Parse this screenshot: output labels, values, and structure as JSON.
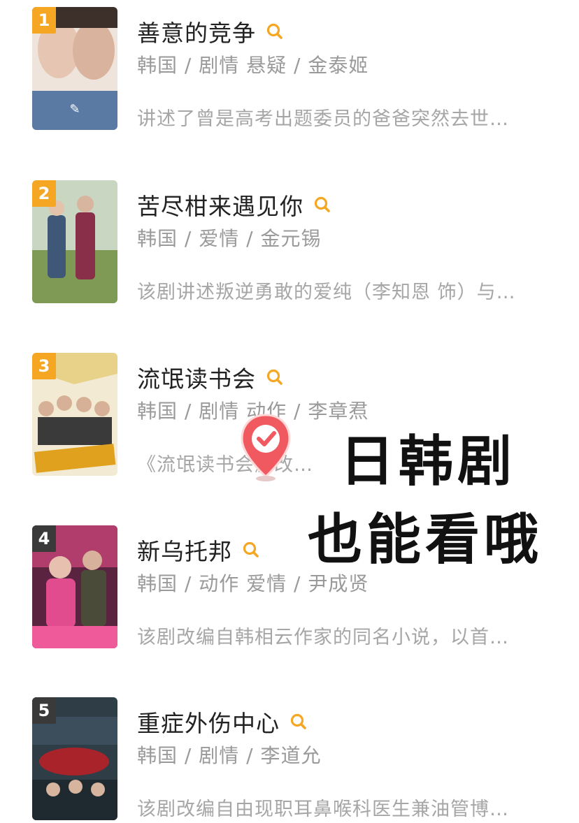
{
  "items": [
    {
      "rank": "1",
      "title": "善意的竞争",
      "meta": "韩国 / 剧情 悬疑 / 金泰姬",
      "desc": "讲述了曾是高考出题委员的爸爸突然去世…",
      "poster_colors": [
        "#e9d8cc",
        "#c89b84",
        "#4a6a8c"
      ],
      "search_icon": "search-icon"
    },
    {
      "rank": "2",
      "title": "苦尽柑来遇见你",
      "meta": "韩国 / 爱情 / 金元锡",
      "desc": "该剧讲述叛逆勇敢的爱纯（李知恩 饰）与…",
      "poster_colors": [
        "#b9c9b0",
        "#6d8a4c",
        "#8a2f4a"
      ],
      "search_icon": "search-icon"
    },
    {
      "rank": "3",
      "title": "流氓读书会",
      "meta": "韩国 / 剧情 动作 / 李章焄",
      "desc": "《流氓读书会》改编…",
      "poster_colors": [
        "#f2e7c7",
        "#d9a93a",
        "#2c2c2c"
      ],
      "search_icon": "search-icon"
    },
    {
      "rank": "4",
      "title": "新乌托邦",
      "meta": "韩国 / 动作 爱情 / 尹成贤",
      "desc": "该剧改编自韩相云作家的同名小说，以首…",
      "poster_colors": [
        "#d84f8a",
        "#6a2748",
        "#f7c5d5"
      ],
      "search_icon": "search-icon"
    },
    {
      "rank": "5",
      "title": "重症外伤中心",
      "meta": "韩国 / 剧情 / 李道允",
      "desc": "该剧改编自由现职耳鼻喉科医生兼油管博…",
      "poster_colors": [
        "#2b3a44",
        "#a8232a",
        "#d7c9b4"
      ],
      "search_icon": "search-icon"
    }
  ],
  "overlay": {
    "line1": "日韩剧",
    "line2": "也能看哦",
    "icon": "check-pin-icon",
    "colors": {
      "pin": "#f0595f",
      "pin_light": "#ff8f8f",
      "text": "#111111"
    }
  },
  "colors": {
    "accent": "#f5a623",
    "title": "#222222",
    "meta": "#9a9a9a",
    "desc": "#a6a6a6"
  }
}
